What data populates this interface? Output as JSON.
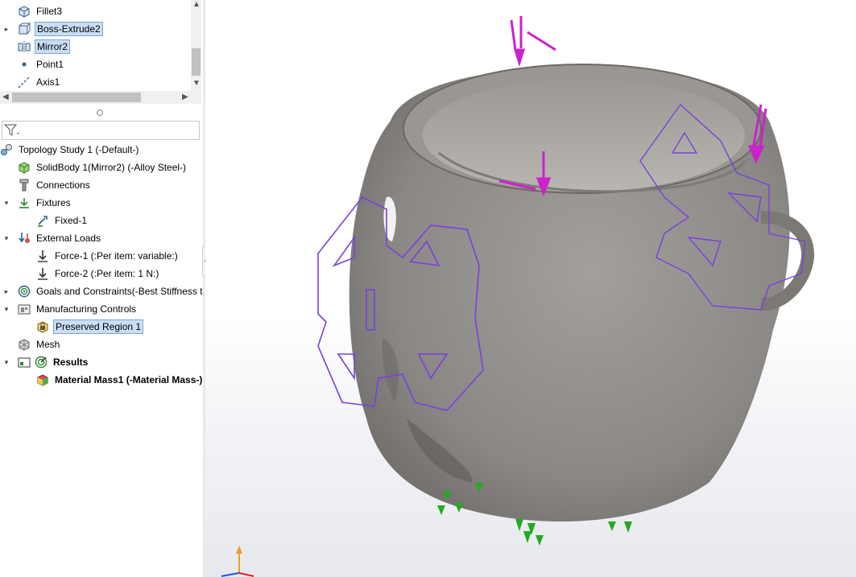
{
  "tree_top": [
    {
      "label": "Fillet3",
      "icon": "fillet-icon"
    },
    {
      "label": "Boss-Extrude2",
      "icon": "boss-extrude-icon"
    },
    {
      "label": "Mirror2",
      "icon": "mirror-icon"
    },
    {
      "label": "Point1",
      "icon": "point-icon"
    },
    {
      "label": "Axis1",
      "icon": "axis-icon"
    }
  ],
  "study": {
    "title": "Topology Study 1 (-Default-)",
    "items": [
      {
        "label": "SolidBody 1(Mirror2) (-Alloy Steel-)",
        "icon": "solid-body-icon"
      },
      {
        "label": "Connections",
        "icon": "connections-icon"
      },
      {
        "label": "Fixtures",
        "icon": "fixtures-icon"
      },
      {
        "label": "Fixed-1",
        "icon": "fixed-icon"
      },
      {
        "label": "External Loads",
        "icon": "external-loads-icon"
      },
      {
        "label": "Force-1 (:Per item: variable:)",
        "icon": "force-icon"
      },
      {
        "label": "Force-2 (:Per item: 1 N:)",
        "icon": "force-icon"
      },
      {
        "label": "Goals and Constraints(-Best Stiffness tc",
        "icon": "goals-icon"
      },
      {
        "label": "Manufacturing Controls",
        "icon": "manufacturing-controls-icon"
      },
      {
        "label": "Preserved Region 1",
        "icon": "preserved-region-icon"
      },
      {
        "label": "Mesh",
        "icon": "mesh-icon"
      },
      {
        "label": "Results",
        "icon": "results-icon"
      },
      {
        "label": "Material Mass1 (-Material Mass-)",
        "icon": "material-mass-icon"
      }
    ]
  },
  "filter": {
    "icon": "filter-icon"
  },
  "colors": {
    "selection": "#c9def5",
    "model": "#8a8784",
    "preserved_outline": "#7b3fe0",
    "load_arrows": "#cc22cc",
    "fixture_arrows": "#22aa22"
  }
}
